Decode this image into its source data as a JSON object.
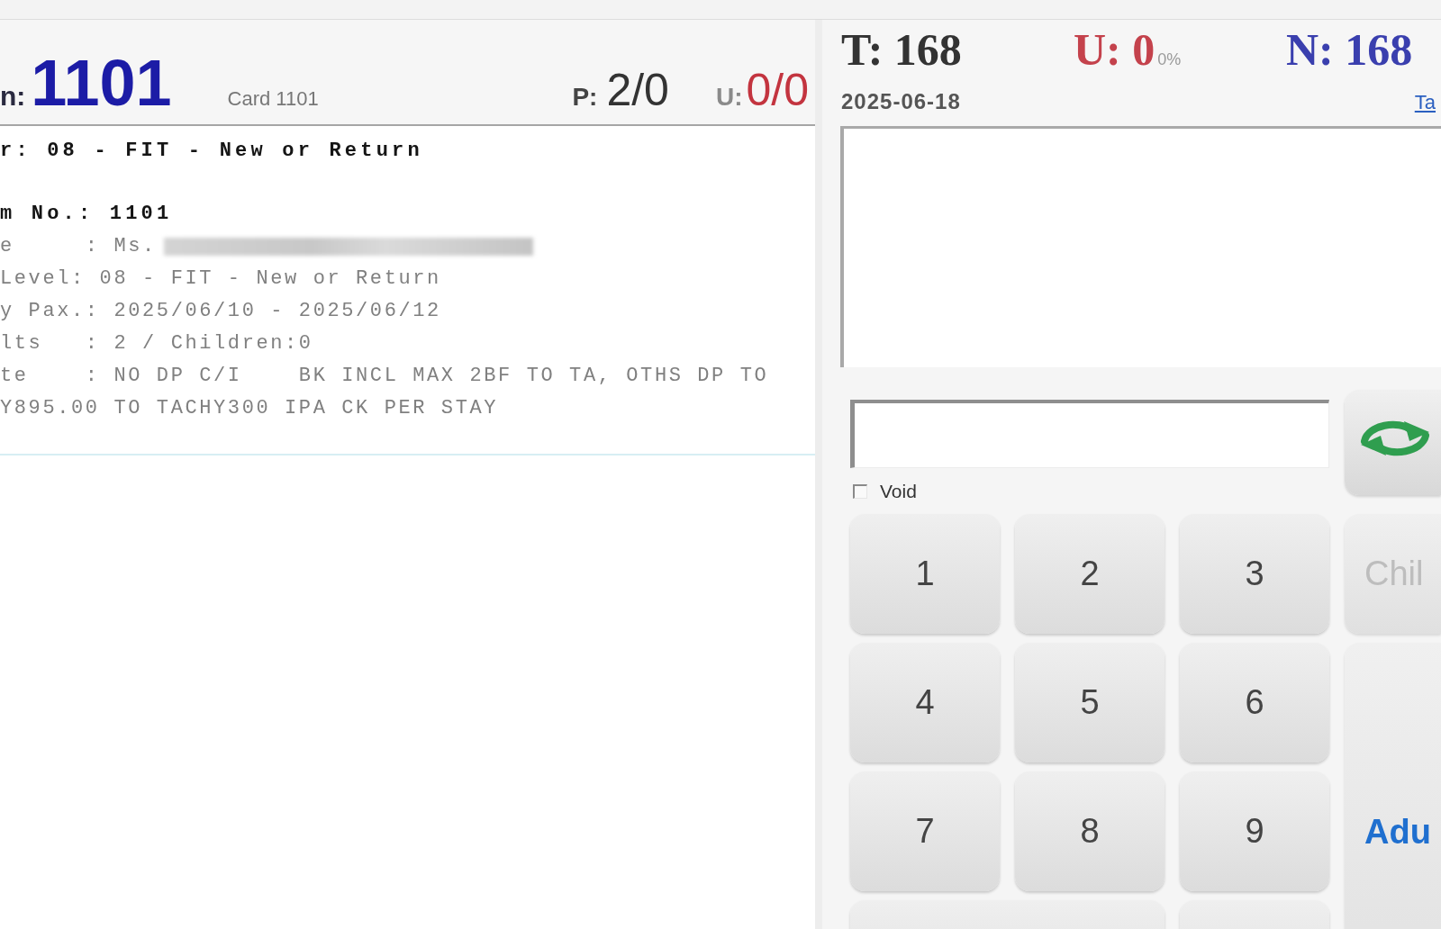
{
  "room_panel": {
    "room_label": "n:",
    "room_number": "1101",
    "card": "Card 1101",
    "pax_label": "P:",
    "pax_value": "2/0",
    "used_label": "U:",
    "used_value": "0/0",
    "details": [
      {
        "kind": "heading",
        "text": "r: 08 - FIT - New or Return",
        "redacted": false
      },
      {
        "kind": "bold",
        "text": "m No.: 1101",
        "redacted": false
      },
      {
        "kind": "plain",
        "text": "e     : Ms.",
        "redacted": true
      },
      {
        "kind": "plain",
        "text": "Level: 08 - FIT - New or Return",
        "redacted": false
      },
      {
        "kind": "plain",
        "text": "y Pax.: 2025/06/10 - 2025/06/12",
        "redacted": false
      },
      {
        "kind": "plain",
        "text": "lts   : 2 / Children:0",
        "redacted": false
      },
      {
        "kind": "plain",
        "text": "te    : NO DP C/I    BK INCL MAX 2BF TO TA, OTHS DP TO Y895.00 TO TACHY300 IPA CK PER STAY",
        "redacted": false
      }
    ]
  },
  "counter_panel": {
    "total": "T: 168",
    "used": "U: 0",
    "used_share": "0%",
    "new": "N: 168",
    "date": "2025-06-18",
    "link": "Ta",
    "void": {
      "label": "Void",
      "checked": false
    },
    "keys": [
      {
        "kind": "digit",
        "label": "1"
      },
      {
        "kind": "digit",
        "label": "2"
      },
      {
        "kind": "digit",
        "label": "3"
      },
      {
        "kind": "digit",
        "label": "4"
      },
      {
        "kind": "digit",
        "label": "5"
      },
      {
        "kind": "digit",
        "label": "6"
      },
      {
        "kind": "digit",
        "label": "7"
      },
      {
        "kind": "digit",
        "label": "8"
      },
      {
        "kind": "digit",
        "label": "9"
      },
      {
        "kind": "blank_wide"
      },
      {
        "kind": "blank"
      }
    ],
    "modes": [
      {
        "label": "Chil",
        "selected": false
      },
      {
        "label": "Adu",
        "selected": true
      }
    ]
  }
}
